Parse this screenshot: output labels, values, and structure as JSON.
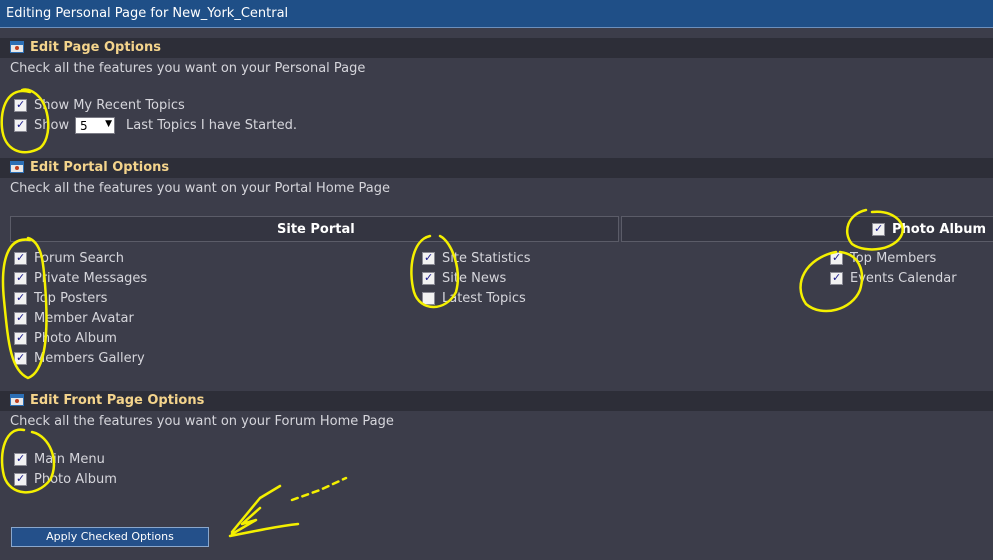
{
  "window": {
    "title": "Editing Personal Page for New_York_Central"
  },
  "page_options": {
    "title": "Edit Page Options",
    "description": "Check all the features you want on your Personal Page",
    "show_recent_label": "Show My Recent Topics",
    "show_label": "Show",
    "topics_count": "5",
    "topics_suffix": "Last Topics I have Started."
  },
  "portal_options": {
    "title": "Edit Portal Options",
    "description": "Check all the features you want on your Portal Home Page",
    "site_portal_header": "Site Portal",
    "photo_album_header": "Photo Album",
    "column1": [
      "Forum Search",
      "Private Messages",
      "Top Posters",
      "Member Avatar",
      "Photo Album",
      "Members Gallery"
    ],
    "column2": [
      "Site Statistics",
      "Site News",
      "Latest Topics"
    ],
    "column3": [
      "Top Members",
      "Events Calendar"
    ]
  },
  "front_page_options": {
    "title": "Edit Front Page Options",
    "description": "Check all the features you want on your Forum Home Page",
    "items": [
      "Main Menu",
      "Photo Album"
    ]
  },
  "apply_button": {
    "label": "Apply Checked Options"
  },
  "colors": {
    "background": "#3c3d4a",
    "titlebar": "#1f4f87",
    "section_title": "#f4d48c",
    "annotation": "#f4f000"
  }
}
